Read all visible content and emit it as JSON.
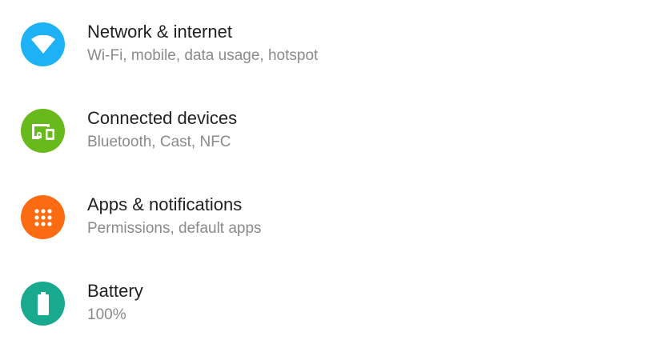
{
  "settings": {
    "items": [
      {
        "title": "Network & internet",
        "subtitle": "Wi-Fi, mobile, data usage, hotspot",
        "icon": "wifi-icon",
        "color": "#1fb1f5"
      },
      {
        "title": "Connected devices",
        "subtitle": "Bluetooth, Cast, NFC",
        "icon": "devices-icon",
        "color": "#67b91c"
      },
      {
        "title": "Apps & notifications",
        "subtitle": "Permissions, default apps",
        "icon": "apps-grid-icon",
        "color": "#fb6b12"
      },
      {
        "title": "Battery",
        "subtitle": "100%",
        "icon": "battery-icon",
        "color": "#19a98f"
      }
    ]
  }
}
